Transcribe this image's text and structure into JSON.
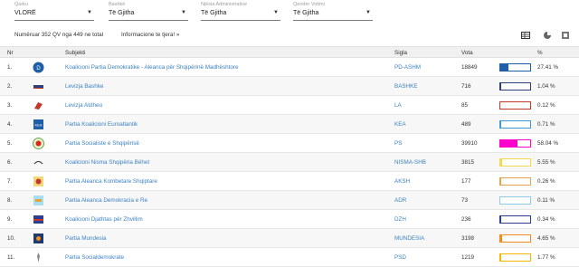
{
  "filters": [
    {
      "label": "Qarku",
      "value": "VLORË"
    },
    {
      "label": "Bashkë",
      "value": "Të Gjitha"
    },
    {
      "label": "Njësia Administrative",
      "value": "Të Gjitha"
    },
    {
      "label": "Qendër Votimi",
      "value": "Të Gjitha"
    }
  ],
  "info": {
    "count_text": "Numëruar 352 QV nga 449 ne total",
    "more_info": "Informacione te tjera! »"
  },
  "view_icons": [
    "table-view-icon",
    "pie-chart-icon",
    "export-icon"
  ],
  "table": {
    "headers": {
      "nr": "Nr",
      "subject": "Subjekti",
      "sigla": "Sigla",
      "vota": "Vota",
      "pct": "%"
    },
    "rows": [
      {
        "nr": "1.",
        "name": "Koalicioni Partia Demokratike - Aleanca për Shqipërinë Madhështore",
        "sigla": "PD-ASHM",
        "vota": "18849",
        "pct": "27.41 %",
        "share": 27.41,
        "color": "#1f5fa8",
        "logo": "pd-logo"
      },
      {
        "nr": "2.",
        "name": "Levizja Bashke",
        "sigla": "BASHKE",
        "vota": "716",
        "pct": "1.04 %",
        "share": 1.04,
        "color": "#2b3f7a",
        "logo": "bashke-logo"
      },
      {
        "nr": "3.",
        "name": "Levizja Atdheu",
        "sigla": "LA",
        "vota": "85",
        "pct": "0.12 %",
        "share": 0.12,
        "color": "#c0392b",
        "logo": "atdheu-logo"
      },
      {
        "nr": "4.",
        "name": "Partia Koalicioni Euroatlantik",
        "sigla": "KEA",
        "vota": "489",
        "pct": "0.71 %",
        "share": 0.71,
        "color": "#3a9bd5",
        "logo": "kea-logo"
      },
      {
        "nr": "5.",
        "name": "Partia Socialiste e Shqipërisë",
        "sigla": "PS",
        "vota": "39910",
        "pct": "58.04 %",
        "share": 58.04,
        "color": "#ff00cc",
        "logo": "ps-logo"
      },
      {
        "nr": "6.",
        "name": "Koalicioni Nisma Shqipëria Bëhet",
        "sigla": "NISMA-SHB",
        "vota": "3815",
        "pct": "5.55 %",
        "share": 5.55,
        "color": "#f2d94e",
        "logo": "nisma-logo"
      },
      {
        "nr": "7.",
        "name": "Partia Aleanca Kombetare Shqiptare",
        "sigla": "AKSH",
        "vota": "177",
        "pct": "0.26 %",
        "share": 0.26,
        "color": "#e8a24a",
        "logo": "aksh-logo"
      },
      {
        "nr": "8.",
        "name": "Partia Aleanca Demokracia e Re",
        "sigla": "ADR",
        "vota": "73",
        "pct": "0.11 %",
        "share": 0.11,
        "color": "#8ecbe8",
        "logo": "adr-logo"
      },
      {
        "nr": "9.",
        "name": "Koalicioni Djathtas për Zhvillim",
        "sigla": "DZH",
        "vota": "236",
        "pct": "0.34 %",
        "share": 0.34,
        "color": "#2c3e8f",
        "logo": "dzh-logo"
      },
      {
        "nr": "10.",
        "name": "Partia Mundesia",
        "sigla": "MUNDESIA",
        "vota": "3198",
        "pct": "4.65 %",
        "share": 4.65,
        "color": "#f28c1a",
        "logo": "mundesia-logo"
      },
      {
        "nr": "11.",
        "name": "Partia Socialdemokrate",
        "sigla": "PSD",
        "vota": "1219",
        "pct": "1.77 %",
        "share": 1.77,
        "color": "#f2b705",
        "logo": "psd-logo"
      }
    ]
  }
}
